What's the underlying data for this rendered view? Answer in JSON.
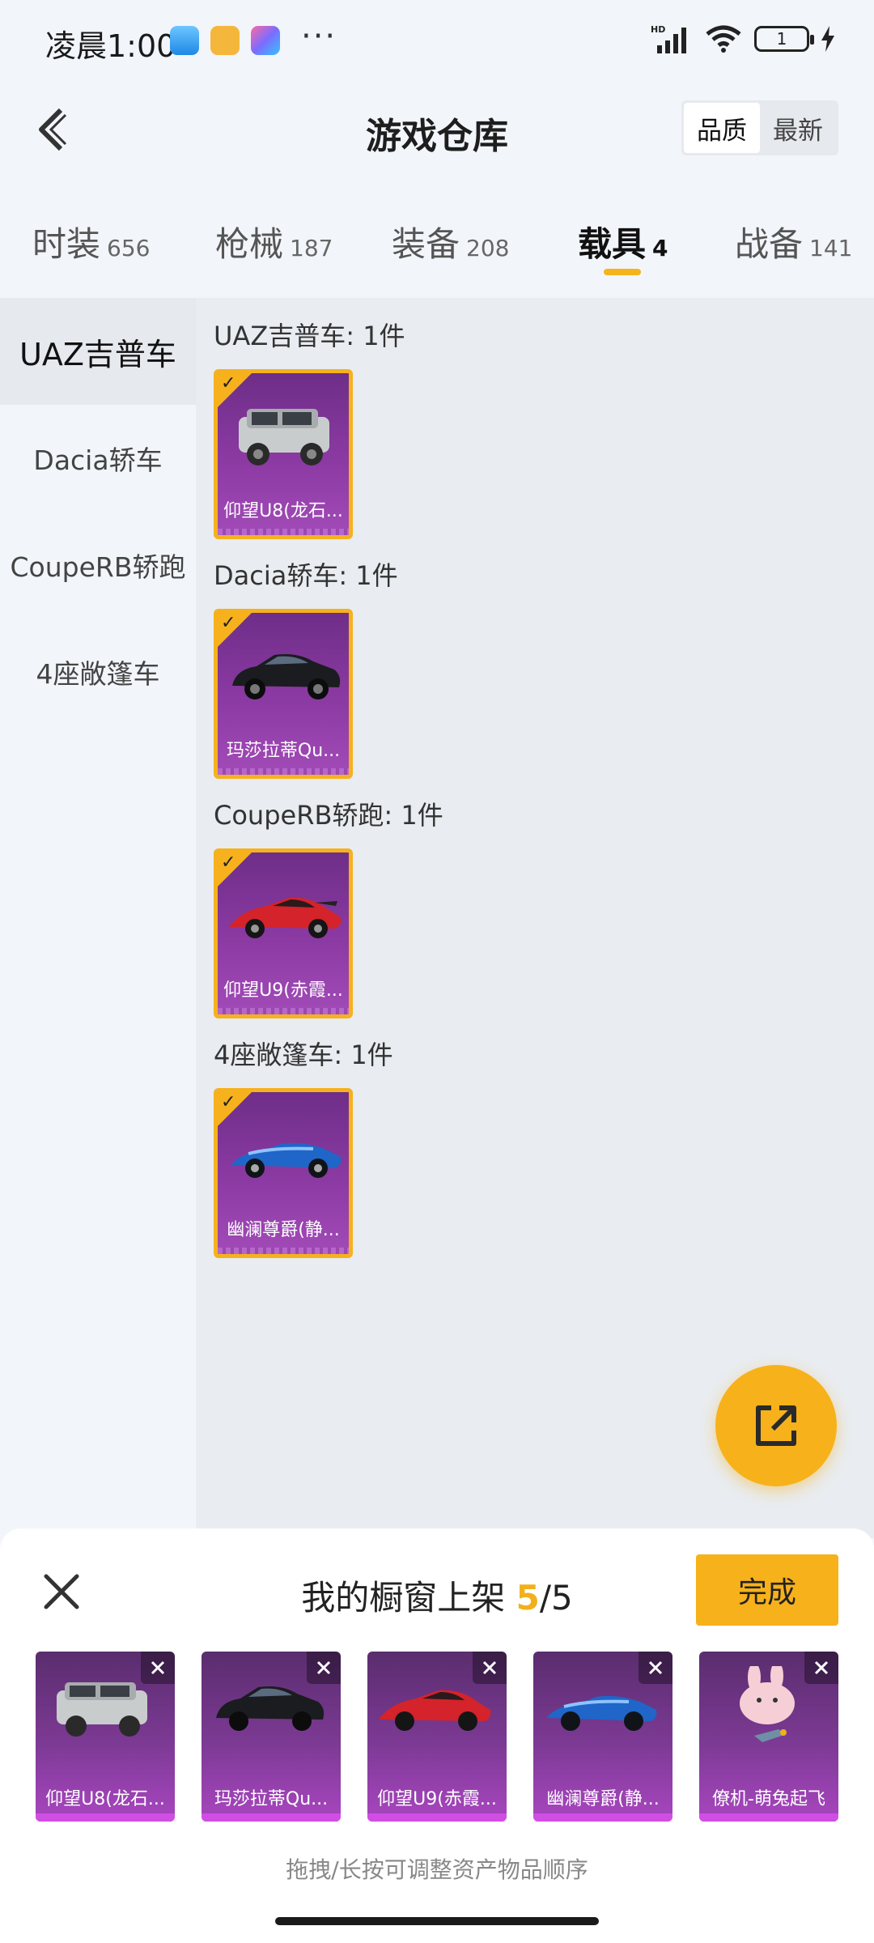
{
  "status": {
    "time": "凌晨1:00",
    "dots": "···",
    "battery": "1"
  },
  "header": {
    "title": "游戏仓库",
    "sort": [
      "品质",
      "最新"
    ]
  },
  "tabs": [
    {
      "label": "时装",
      "count": "656"
    },
    {
      "label": "枪械",
      "count": "187"
    },
    {
      "label": "装备",
      "count": "208"
    },
    {
      "label": "载具",
      "count": "4"
    },
    {
      "label": "战备",
      "count": "141"
    }
  ],
  "sidebar": [
    "UAZ吉普车",
    "Dacia轿车",
    "CoupeRB轿跑",
    "4座敞篷车"
  ],
  "groups": [
    {
      "title": "UAZ吉普车: 1件",
      "item": "仰望U8(龙石..."
    },
    {
      "title": "Dacia轿车: 1件",
      "item": "玛莎拉蒂Qu..."
    },
    {
      "title": "CoupeRB轿跑: 1件",
      "item": "仰望U9(赤霞..."
    },
    {
      "title": "4座敞篷车: 1件",
      "item": "幽澜尊爵(静..."
    }
  ],
  "sheet": {
    "title_prefix": "我的橱窗上架 ",
    "count_current": "5",
    "count_total": "/5",
    "done": "完成",
    "hint": "拖拽/长按可调整资产物品顺序",
    "items": [
      "仰望U8(龙石...",
      "玛莎拉蒂Qu...",
      "仰望U9(赤霞...",
      "幽澜尊爵(静...",
      "僚机-萌兔起飞"
    ]
  },
  "colors": {
    "accent": "#f7b11a",
    "card_purple": "#8c3aa3"
  }
}
